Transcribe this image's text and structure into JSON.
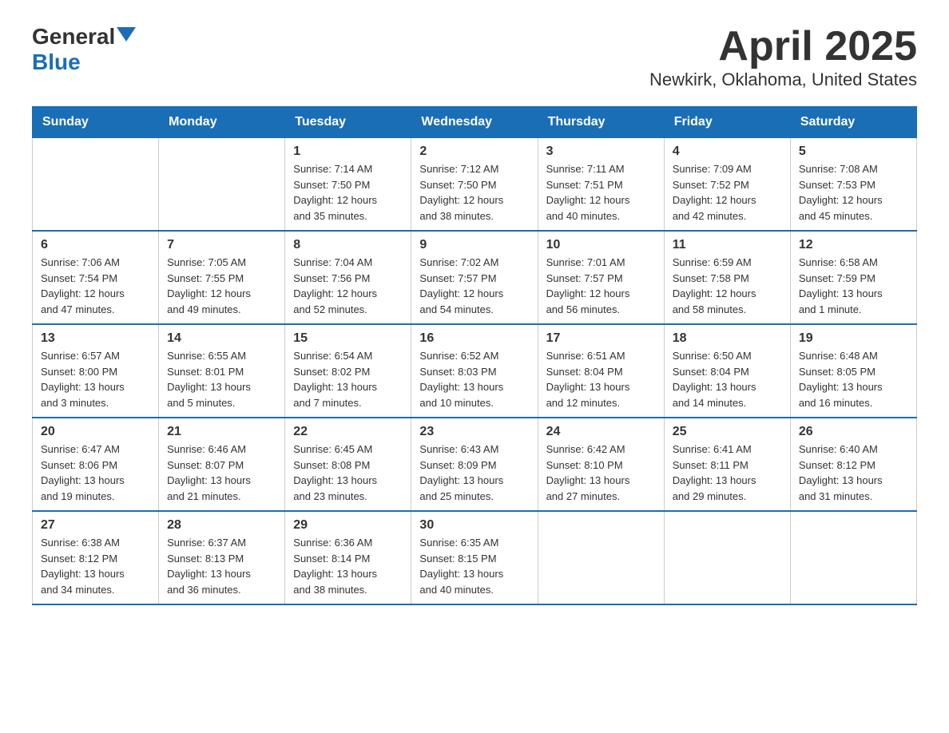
{
  "logo": {
    "general": "General",
    "blue": "Blue"
  },
  "title": "April 2025",
  "subtitle": "Newkirk, Oklahoma, United States",
  "days_of_week": [
    "Sunday",
    "Monday",
    "Tuesday",
    "Wednesday",
    "Thursday",
    "Friday",
    "Saturday"
  ],
  "weeks": [
    [
      {
        "day": "",
        "info": ""
      },
      {
        "day": "",
        "info": ""
      },
      {
        "day": "1",
        "info": "Sunrise: 7:14 AM\nSunset: 7:50 PM\nDaylight: 12 hours\nand 35 minutes."
      },
      {
        "day": "2",
        "info": "Sunrise: 7:12 AM\nSunset: 7:50 PM\nDaylight: 12 hours\nand 38 minutes."
      },
      {
        "day": "3",
        "info": "Sunrise: 7:11 AM\nSunset: 7:51 PM\nDaylight: 12 hours\nand 40 minutes."
      },
      {
        "day": "4",
        "info": "Sunrise: 7:09 AM\nSunset: 7:52 PM\nDaylight: 12 hours\nand 42 minutes."
      },
      {
        "day": "5",
        "info": "Sunrise: 7:08 AM\nSunset: 7:53 PM\nDaylight: 12 hours\nand 45 minutes."
      }
    ],
    [
      {
        "day": "6",
        "info": "Sunrise: 7:06 AM\nSunset: 7:54 PM\nDaylight: 12 hours\nand 47 minutes."
      },
      {
        "day": "7",
        "info": "Sunrise: 7:05 AM\nSunset: 7:55 PM\nDaylight: 12 hours\nand 49 minutes."
      },
      {
        "day": "8",
        "info": "Sunrise: 7:04 AM\nSunset: 7:56 PM\nDaylight: 12 hours\nand 52 minutes."
      },
      {
        "day": "9",
        "info": "Sunrise: 7:02 AM\nSunset: 7:57 PM\nDaylight: 12 hours\nand 54 minutes."
      },
      {
        "day": "10",
        "info": "Sunrise: 7:01 AM\nSunset: 7:57 PM\nDaylight: 12 hours\nand 56 minutes."
      },
      {
        "day": "11",
        "info": "Sunrise: 6:59 AM\nSunset: 7:58 PM\nDaylight: 12 hours\nand 58 minutes."
      },
      {
        "day": "12",
        "info": "Sunrise: 6:58 AM\nSunset: 7:59 PM\nDaylight: 13 hours\nand 1 minute."
      }
    ],
    [
      {
        "day": "13",
        "info": "Sunrise: 6:57 AM\nSunset: 8:00 PM\nDaylight: 13 hours\nand 3 minutes."
      },
      {
        "day": "14",
        "info": "Sunrise: 6:55 AM\nSunset: 8:01 PM\nDaylight: 13 hours\nand 5 minutes."
      },
      {
        "day": "15",
        "info": "Sunrise: 6:54 AM\nSunset: 8:02 PM\nDaylight: 13 hours\nand 7 minutes."
      },
      {
        "day": "16",
        "info": "Sunrise: 6:52 AM\nSunset: 8:03 PM\nDaylight: 13 hours\nand 10 minutes."
      },
      {
        "day": "17",
        "info": "Sunrise: 6:51 AM\nSunset: 8:04 PM\nDaylight: 13 hours\nand 12 minutes."
      },
      {
        "day": "18",
        "info": "Sunrise: 6:50 AM\nSunset: 8:04 PM\nDaylight: 13 hours\nand 14 minutes."
      },
      {
        "day": "19",
        "info": "Sunrise: 6:48 AM\nSunset: 8:05 PM\nDaylight: 13 hours\nand 16 minutes."
      }
    ],
    [
      {
        "day": "20",
        "info": "Sunrise: 6:47 AM\nSunset: 8:06 PM\nDaylight: 13 hours\nand 19 minutes."
      },
      {
        "day": "21",
        "info": "Sunrise: 6:46 AM\nSunset: 8:07 PM\nDaylight: 13 hours\nand 21 minutes."
      },
      {
        "day": "22",
        "info": "Sunrise: 6:45 AM\nSunset: 8:08 PM\nDaylight: 13 hours\nand 23 minutes."
      },
      {
        "day": "23",
        "info": "Sunrise: 6:43 AM\nSunset: 8:09 PM\nDaylight: 13 hours\nand 25 minutes."
      },
      {
        "day": "24",
        "info": "Sunrise: 6:42 AM\nSunset: 8:10 PM\nDaylight: 13 hours\nand 27 minutes."
      },
      {
        "day": "25",
        "info": "Sunrise: 6:41 AM\nSunset: 8:11 PM\nDaylight: 13 hours\nand 29 minutes."
      },
      {
        "day": "26",
        "info": "Sunrise: 6:40 AM\nSunset: 8:12 PM\nDaylight: 13 hours\nand 31 minutes."
      }
    ],
    [
      {
        "day": "27",
        "info": "Sunrise: 6:38 AM\nSunset: 8:12 PM\nDaylight: 13 hours\nand 34 minutes."
      },
      {
        "day": "28",
        "info": "Sunrise: 6:37 AM\nSunset: 8:13 PM\nDaylight: 13 hours\nand 36 minutes."
      },
      {
        "day": "29",
        "info": "Sunrise: 6:36 AM\nSunset: 8:14 PM\nDaylight: 13 hours\nand 38 minutes."
      },
      {
        "day": "30",
        "info": "Sunrise: 6:35 AM\nSunset: 8:15 PM\nDaylight: 13 hours\nand 40 minutes."
      },
      {
        "day": "",
        "info": ""
      },
      {
        "day": "",
        "info": ""
      },
      {
        "day": "",
        "info": ""
      }
    ]
  ]
}
